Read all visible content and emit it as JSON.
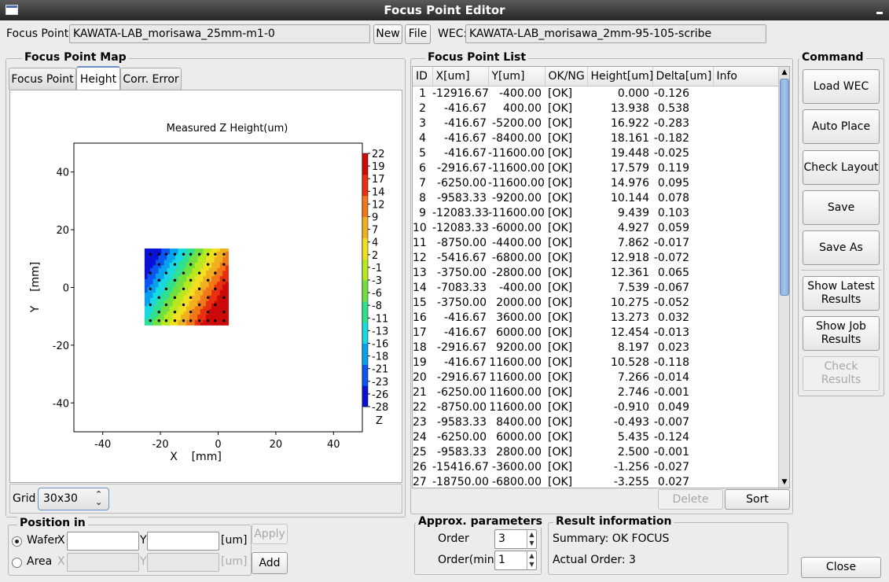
{
  "window": {
    "title": "Focus Point Editor"
  },
  "top": {
    "focus_point_label": "Focus Point:",
    "focus_point_value": "KAWATA-LAB_morisawa_25mm-m1-0",
    "new_label": "New",
    "file_label": "File",
    "wec_label": "WEC:",
    "wec_value": "KAWATA-LAB_morisawa_2mm-95-105-scribe"
  },
  "map": {
    "group_title": "Focus Point Map",
    "tabs": [
      "Focus Point",
      "Height",
      "Corr. Error"
    ],
    "active_tab": "Height",
    "grid_label": "Grid",
    "grid_value": "30x30"
  },
  "chart_data": {
    "type": "heatmap",
    "title": "Measured Z Height(um)",
    "xlabel": "X    [mm]",
    "ylabel": "Y    [mm]",
    "xlim": [
      -50,
      50
    ],
    "ylim": [
      -50,
      50
    ],
    "xticks": [
      "-40",
      "-20",
      "0",
      "20",
      "40"
    ],
    "yticks": [
      "40",
      "20",
      "0",
      "-20",
      "-40"
    ],
    "colorbar_label": "Z",
    "colorbar_ticks": [
      "22",
      "19",
      "17",
      "14",
      "12",
      "9",
      "7",
      "4",
      "2",
      "-1",
      "-3",
      "-6",
      "-8",
      "-11",
      "-13",
      "-16",
      "-18",
      "-21",
      "-23",
      "-26",
      "-28"
    ],
    "colors": [
      "#0a10d4",
      "#0a55f0",
      "#0aa0f0",
      "#18d8e0",
      "#30e090",
      "#70e040",
      "#b8e820",
      "#f0e020",
      "#f0b020",
      "#f07818",
      "#e83010",
      "#cc0a0a"
    ]
  },
  "position": {
    "group_title": "Position in",
    "wafer_label": "Wafer",
    "area_label": "Area",
    "x_label": "X",
    "y_label": "Y",
    "unit": "[um]",
    "apply_label": "Apply",
    "add_label": "Add"
  },
  "list": {
    "group_title": "Focus Point List",
    "columns": [
      "ID",
      "X[um]",
      "Y[um]",
      "OK/NG",
      "Height[um]",
      "Delta[um]",
      "Info"
    ],
    "rows": [
      [
        "1",
        "-12916.67",
        "-400.00",
        "[OK]",
        "0.000",
        "-0.126"
      ],
      [
        "2",
        "-416.67",
        "400.00",
        "[OK]",
        "13.938",
        "0.538"
      ],
      [
        "3",
        "-416.67",
        "-5200.00",
        "[OK]",
        "16.922",
        "-0.283"
      ],
      [
        "4",
        "-416.67",
        "-8400.00",
        "[OK]",
        "18.161",
        "-0.182"
      ],
      [
        "5",
        "-416.67",
        "-11600.00",
        "[OK]",
        "19.448",
        "-0.025"
      ],
      [
        "6",
        "-2916.67",
        "-11600.00",
        "[OK]",
        "17.579",
        "0.119"
      ],
      [
        "7",
        "-6250.00",
        "-11600.00",
        "[OK]",
        "14.976",
        "0.095"
      ],
      [
        "8",
        "-9583.33",
        "-9200.00",
        "[OK]",
        "10.144",
        "0.078"
      ],
      [
        "9",
        "-12083.33",
        "-11600.00",
        "[OK]",
        "9.439",
        "0.103"
      ],
      [
        "10",
        "-12083.33",
        "-6000.00",
        "[OK]",
        "4.927",
        "0.059"
      ],
      [
        "11",
        "-8750.00",
        "-4400.00",
        "[OK]",
        "7.862",
        "-0.017"
      ],
      [
        "12",
        "-5416.67",
        "-6800.00",
        "[OK]",
        "12.918",
        "-0.072"
      ],
      [
        "13",
        "-3750.00",
        "-2800.00",
        "[OK]",
        "12.361",
        "0.065"
      ],
      [
        "14",
        "-7083.33",
        "-400.00",
        "[OK]",
        "7.539",
        "-0.067"
      ],
      [
        "15",
        "-3750.00",
        "2000.00",
        "[OK]",
        "10.275",
        "-0.052"
      ],
      [
        "16",
        "-416.67",
        "3600.00",
        "[OK]",
        "13.273",
        "0.032"
      ],
      [
        "17",
        "-416.67",
        "6000.00",
        "[OK]",
        "12.454",
        "-0.013"
      ],
      [
        "18",
        "-2916.67",
        "9200.00",
        "[OK]",
        "8.197",
        "0.023"
      ],
      [
        "19",
        "-416.67",
        "11600.00",
        "[OK]",
        "10.528",
        "-0.118"
      ],
      [
        "20",
        "-2916.67",
        "11600.00",
        "[OK]",
        "7.266",
        "-0.014"
      ],
      [
        "21",
        "-6250.00",
        "11600.00",
        "[OK]",
        "2.746",
        "-0.001"
      ],
      [
        "22",
        "-8750.00",
        "11600.00",
        "[OK]",
        "-0.910",
        "0.049"
      ],
      [
        "23",
        "-9583.33",
        "8400.00",
        "[OK]",
        "-0.493",
        "-0.007"
      ],
      [
        "24",
        "-6250.00",
        "6000.00",
        "[OK]",
        "5.435",
        "-0.124"
      ],
      [
        "25",
        "-9583.33",
        "2800.00",
        "[OK]",
        "2.500",
        "-0.001"
      ],
      [
        "26",
        "-15416.67",
        "-3600.00",
        "[OK]",
        "-1.256",
        "-0.027"
      ],
      [
        "27",
        "-18750.00",
        "-6800.00",
        "[OK]",
        "-3.255",
        "0.027"
      ]
    ],
    "delete_label": "Delete",
    "sort_label": "Sort"
  },
  "approx": {
    "group_title": "Approx. parameters",
    "order_label": "Order",
    "order_value": "3",
    "order_min_label": "Order(min)",
    "order_min_value": "1"
  },
  "result": {
    "group_title": "Result information",
    "summary": "Summary: OK FOCUS",
    "actual_order": "Actual Order: 3"
  },
  "command": {
    "group_title": "Command",
    "load_wec": "Load WEC",
    "auto_place": "Auto Place",
    "check_layout": "Check Layout",
    "save": "Save",
    "save_as": "Save As",
    "show_latest": "Show Latest Results",
    "show_job": "Show Job Results",
    "check_results": "Check Results",
    "close": "Close"
  }
}
